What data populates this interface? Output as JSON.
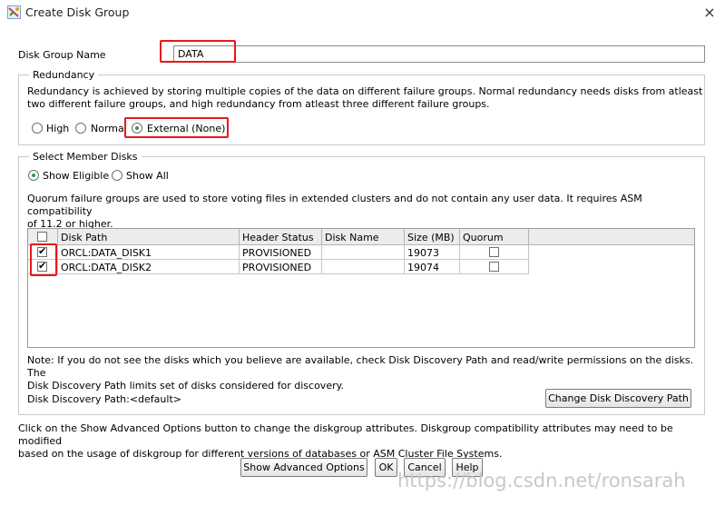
{
  "window": {
    "title": "Create Disk Group",
    "close_glyph": "×",
    "icon": "disk-group-icon"
  },
  "disk_group_name": {
    "label": "Disk Group Name",
    "value": "DATA"
  },
  "redundancy": {
    "legend": "Redundancy",
    "description_line1": "Redundancy is achieved by storing multiple copies of the data on different failure groups. Normal redundancy needs disks from atleast",
    "description_line2": "two different failure groups, and high redundancy from atleast three different failure groups.",
    "options": [
      {
        "label": "High",
        "selected": false
      },
      {
        "label": "Norma",
        "selected": false
      },
      {
        "label": "External (None)",
        "selected": true
      }
    ]
  },
  "member_disks": {
    "legend": "Select Member Disks",
    "filters": [
      {
        "label": "Show Eligible",
        "selected": true
      },
      {
        "label": "Show All",
        "selected": false
      }
    ],
    "quorum_note_line1": "Quorum failure groups are used to store voting files in extended clusters and do not contain any user data. It requires ASM compatibility",
    "quorum_note_line2": "of 11.2 or higher.",
    "columns": [
      "Disk Path",
      "Header Status",
      "Disk Name",
      "Size (MB)",
      "Quorum"
    ],
    "rows": [
      {
        "selected": true,
        "path": "ORCL:DATA_DISK1",
        "status": "PROVISIONED",
        "name": "",
        "size": "19073",
        "quorum": false
      },
      {
        "selected": true,
        "path": "ORCL:DATA_DISK2",
        "status": "PROVISIONED",
        "name": "",
        "size": "19074",
        "quorum": false
      }
    ],
    "note_line1": "Note: If you do not see the disks which you believe are available, check Disk Discovery Path and read/write permissions on the disks. The",
    "note_line2": "Disk Discovery Path limits set of disks considered for discovery.",
    "discovery_path_label": "Disk Discovery Path:<default>",
    "change_discovery_button": "Change Disk Discovery Path"
  },
  "footer": {
    "info_line1": "Click on the Show Advanced Options button to change the diskgroup attributes. Diskgroup compatibility attributes may need to be modified",
    "info_line2": "based on the usage of diskgroup for different versions of databases or ASM Cluster File Systems.",
    "buttons": {
      "advanced": "Show Advanced Options",
      "ok": "OK",
      "cancel": "Cancel",
      "help": "Help"
    }
  },
  "watermark": "https://blog.csdn.net/ronsarah",
  "colors": {
    "highlight_red": "#e8171b",
    "radio_selected": "#2c9d3a"
  }
}
